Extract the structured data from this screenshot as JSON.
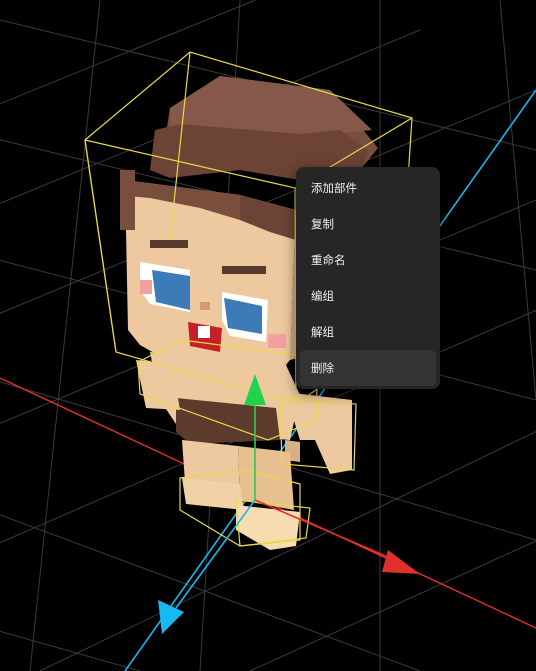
{
  "context_menu": {
    "items": [
      {
        "label": "添加部件"
      },
      {
        "label": "复制"
      },
      {
        "label": "重命名"
      },
      {
        "label": "编组"
      },
      {
        "label": "解组"
      },
      {
        "label": "删除"
      }
    ],
    "hovered_item": "删除"
  },
  "scene": {
    "object": "voxel-character",
    "selection_color": "#e8d94a",
    "axis_colors": {
      "x": "#e0302c",
      "y": "#22d34a",
      "z": "#18b8f0"
    },
    "background": "#000000",
    "grid_color": "#3a3a3a"
  }
}
